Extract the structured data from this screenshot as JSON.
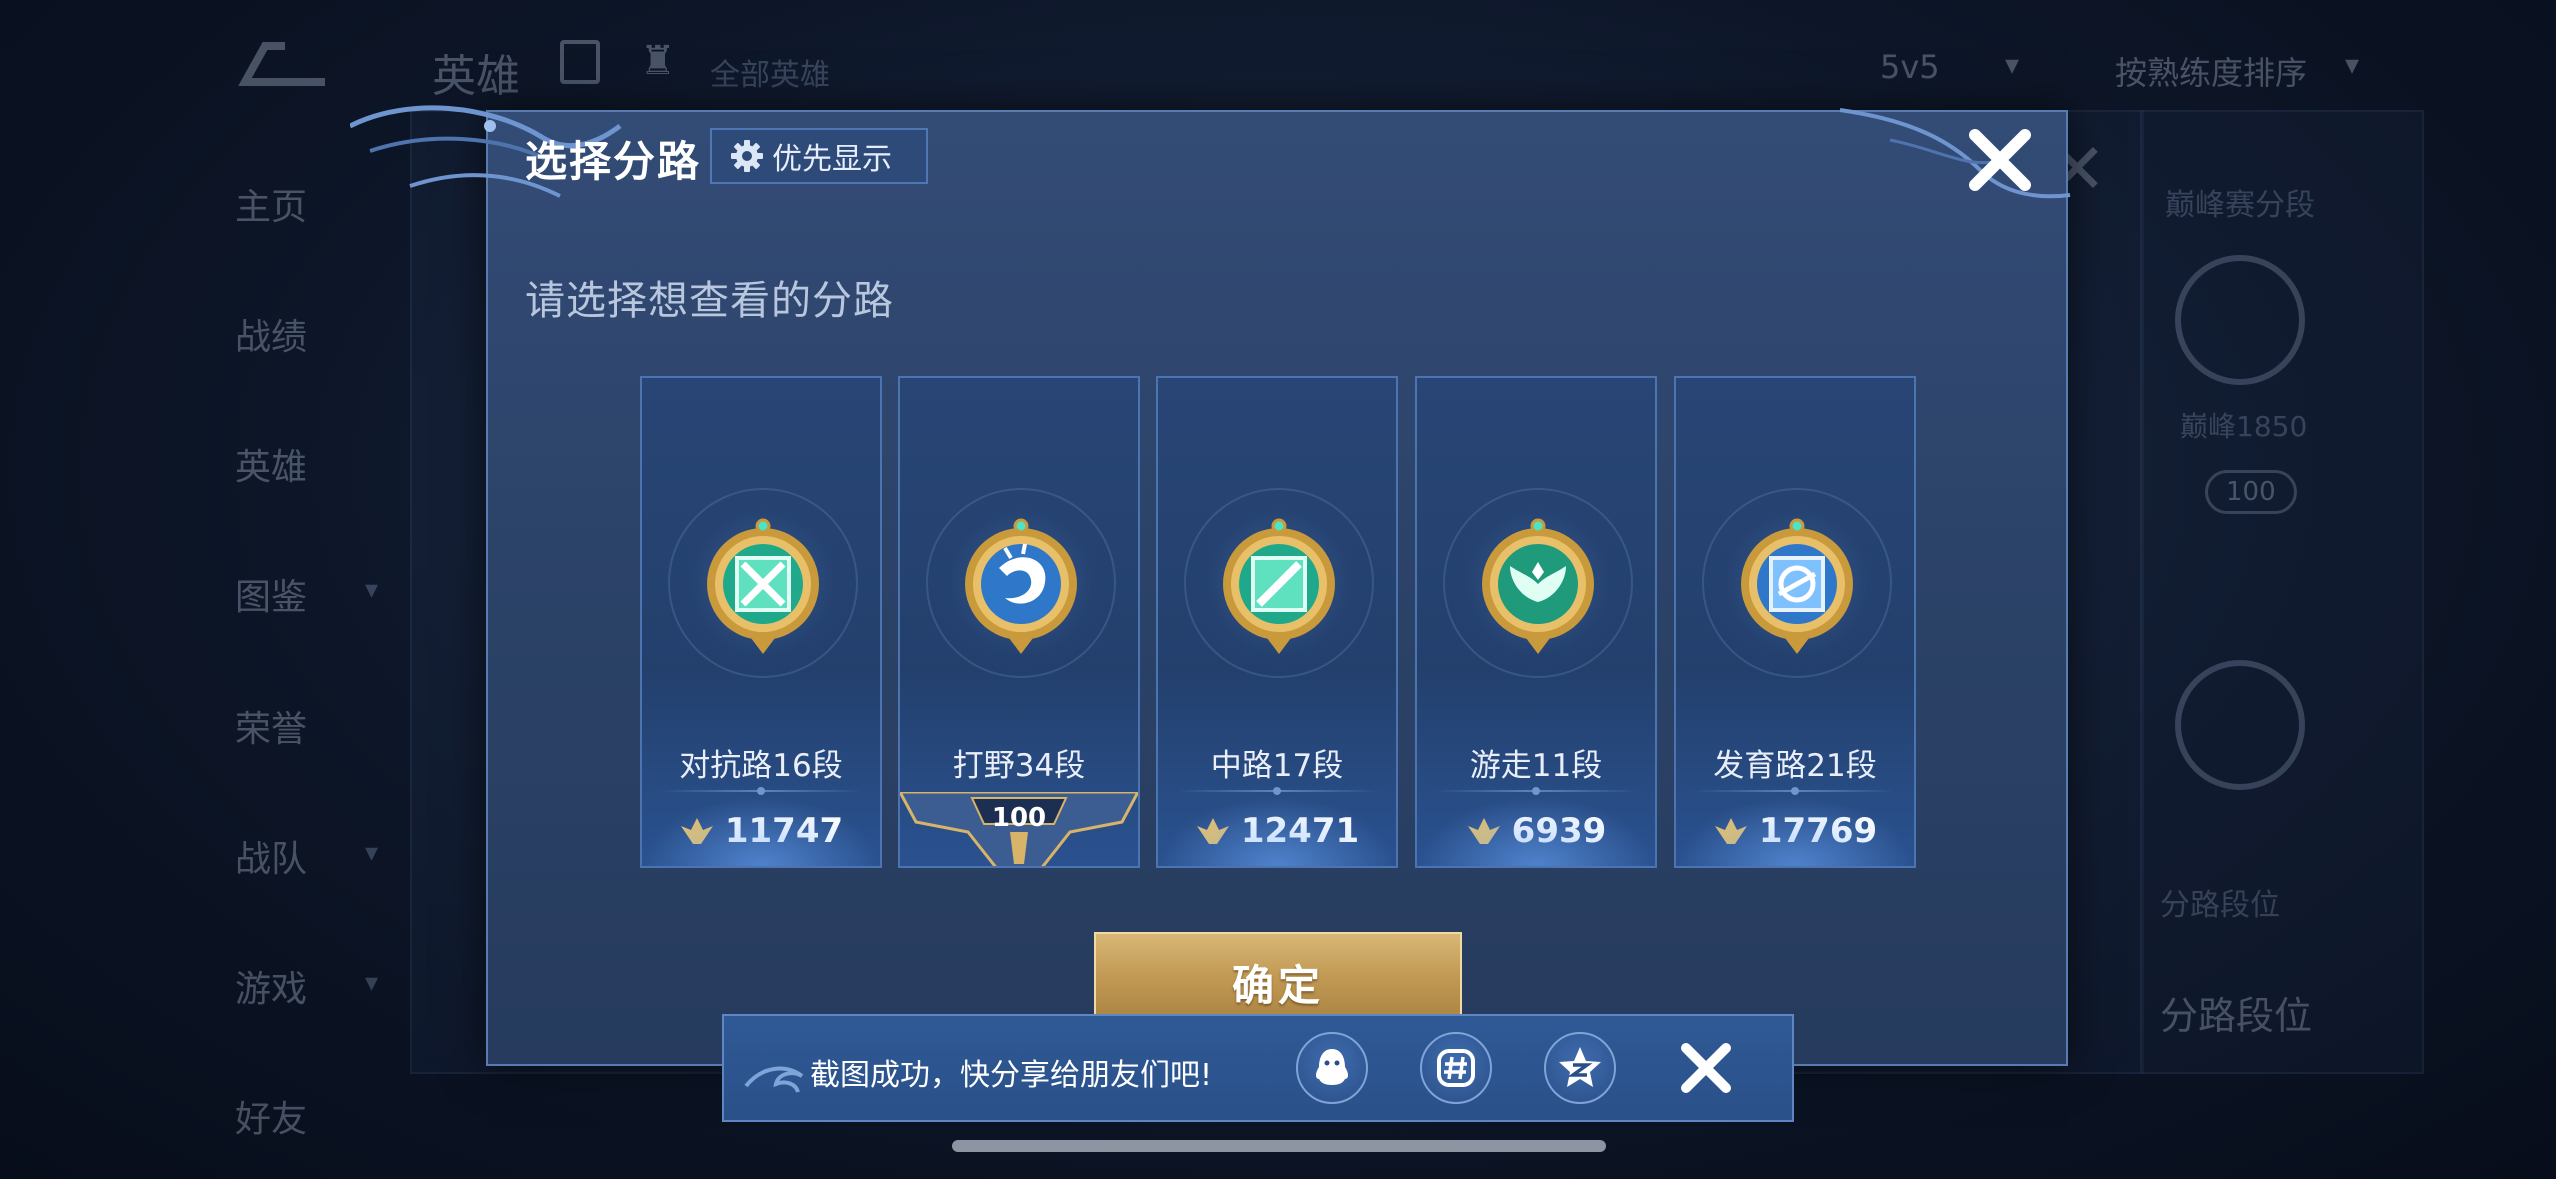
{
  "background": {
    "top_title": "英雄",
    "top_sub": "全部英雄",
    "mode": "5v5",
    "sort": "按熟练度排序",
    "side_nav": [
      "主页",
      "战绩",
      "英雄",
      "图鉴",
      "荣誉",
      "战队",
      "游戏",
      "好友"
    ],
    "right_title": "巅峰赛分段",
    "right_sub": "巅峰1850",
    "right_badge": "100",
    "right_text2": "分路段位",
    "right_text3": "分路段位"
  },
  "dialog": {
    "title": "选择分路",
    "priority_label": "优先显示",
    "subtitle": "请选择想查看的分路",
    "confirm_label": "确定"
  },
  "lanes": [
    {
      "label": "对抗路16段",
      "score": "11747",
      "emblem": "crossed-swords-icon",
      "selected": false
    },
    {
      "label": "打野34段",
      "score": "",
      "badge": "100",
      "emblem": "dragon-icon",
      "selected": true
    },
    {
      "label": "中路17段",
      "score": "12471",
      "emblem": "staff-icon",
      "selected": false
    },
    {
      "label": "游走11段",
      "score": "6939",
      "emblem": "wings-icon",
      "selected": false
    },
    {
      "label": "发育路21段",
      "score": "17769",
      "emblem": "arrow-target-icon",
      "selected": false
    }
  ],
  "toast": {
    "message": "截图成功，快分享给朋友们吧!",
    "share_targets": [
      "qq-icon",
      "wechat-moments-icon",
      "qzone-icon"
    ]
  },
  "colors": {
    "dialog_bg": "#2c4369",
    "card_border": "#4b74b0",
    "gold": "#c29a55",
    "emblem_green": "#1fa98a",
    "emblem_blue": "#2f78c9"
  }
}
